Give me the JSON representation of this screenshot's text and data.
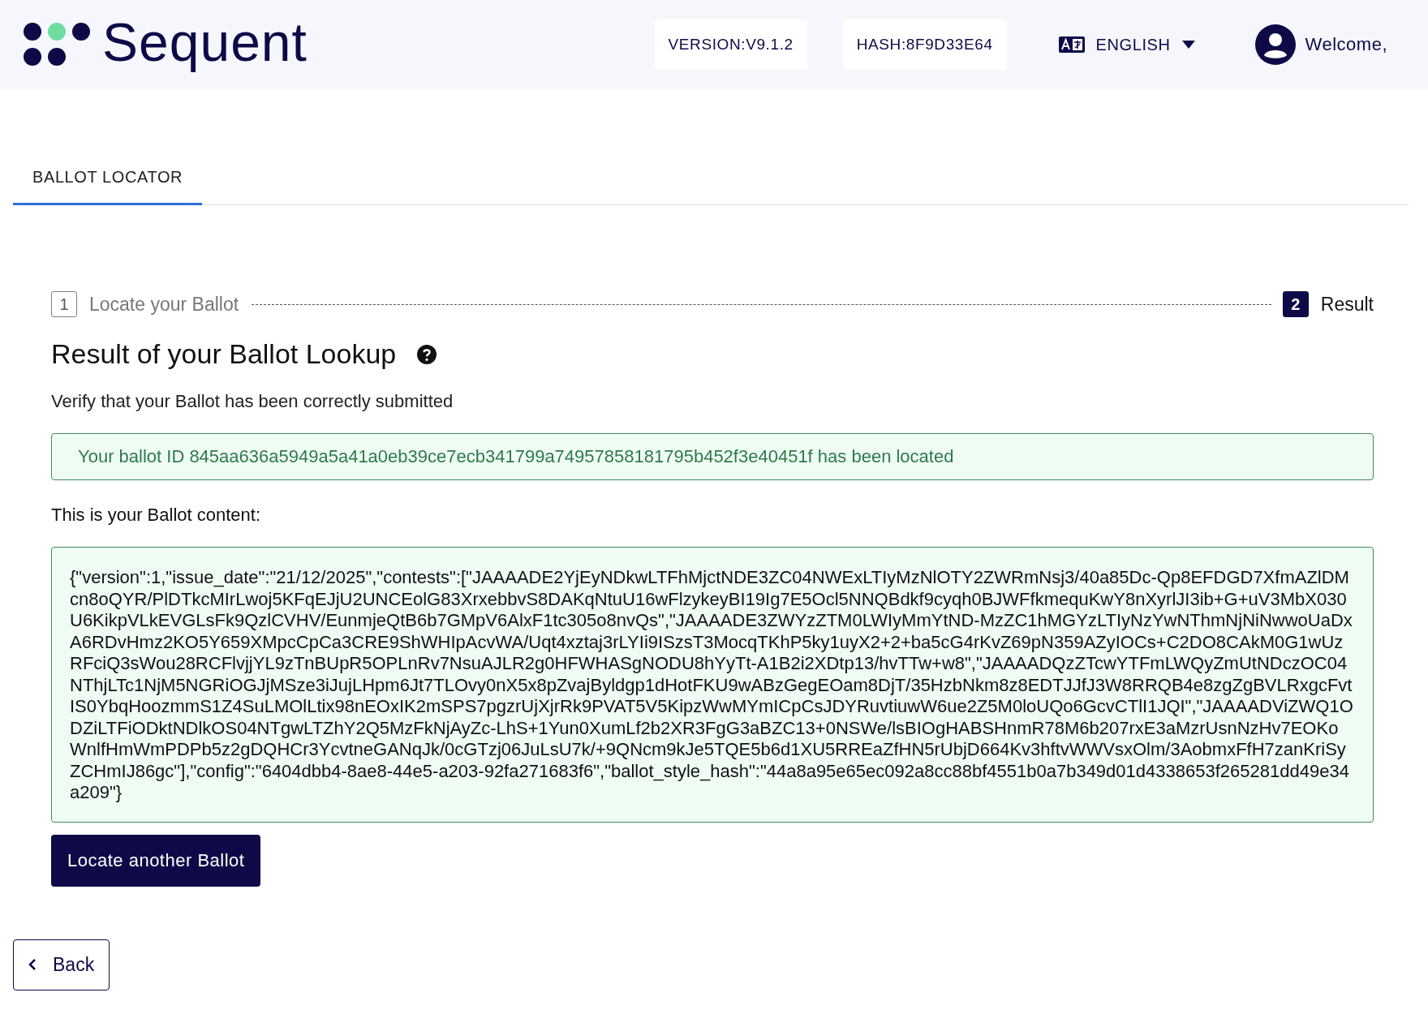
{
  "header": {
    "logo": "Sequent",
    "version": "VERSION:V9.1.2",
    "hash": "HASH:8F9D33E64",
    "language": "ENGLISH",
    "welcome": "Welcome,"
  },
  "tabs": [
    {
      "label": "BALLOT LOCATOR",
      "selected": true
    }
  ],
  "steps": [
    {
      "number": "1",
      "label": "Locate your Ballot",
      "selected": false
    },
    {
      "number": "2",
      "label": "Result",
      "selected": true
    }
  ],
  "title": "Result of your Ballot Lookup",
  "subtitle": "Verify that your Ballot has been correctly submitted",
  "alert": "Your ballot ID 845aa636a5949a5a41a0eb39ce7ecb341799a74957858181795b452f3e40451f has been located",
  "content_label": "This is your Ballot content:",
  "content": "{\"version\":1,\"issue_date\":\"21/12/2025\",\"contests\":[\"JAAAADE2YjEyNDkwLTFhMjctNDE3ZC04NWExLTIyMzNlOTY2ZWRmNsj3/40a85Dc-Qp8EFDGD7XfmAZlDMcn8oQYR/PlDTkcMIrLwoj5KFqEJjU2UNCEolG83XrxebbvS8DAKqNtuU16wFlzykeyBI19Ig7E5Ocl5NNQBdkf9cyqh0BJWFfkmequKwY8nXyrlJI3ib+G+uV3MbX030U6KikpVLkEVGLsFk9QzlCVHV/EunmjeQtB6b7GMpV6AlxF1tc305o8nvQs\",\"JAAAADE3ZWYzZTM0LWIyMmYtND-MzZC1hMGYzLTIyNzYwNThmNjNiNwwoUaDxA6RDvHmz2KO5Y659XMpcCpCa3CRE9ShWHIpAcvWA/Uqt4xztaj3rLYIi9ISzsT3MocqTKhP5ky1uyX2+2+ba5cG4rKvZ69pN359AZyIOCs+C2DO8CAkM0G1wUzRFciQ3sWou28RCFlvjjYL9zTnBUpR5OPLnRv7NsuAJLR2g0HFWHASgNODU8hYyTt-A1B2i2XDtp13/hvTTw+w8\",\"JAAAADQzZTcwYTFmLWQyZmUtNDczOC04NThjLTc1NjM5NGRiOGJjMSze3iJujLHpm6Jt7TLOvy0nX5x8pZvajByldgp1dHotFKU9wABzGegEOam8DjT/35HzbNkm8z8EDTJJfJ3W8RRQB4e8zgZgBVLRxgcFvtIS0YbqHoozmmS1Z4SuLMOlLtix98nEOxIK2mSPS7pgzrUjXjrRk9PVAT5V5KipzWwMYmICpCsJDYRuvtiuwW6ue2Z5M0loUQo6GcvCTlI1JQI\",\"JAAAADViZWQ1ODZiLTFiODktNDlkOS04NTgwLTZhY2Q5MzFkNjAyZc-LhS+1Yun0XumLf2b2XR3FgG3aBZC13+0NSWe/lsBIOgHABSHnmR78M6b207rxE3aMzrUsnNzHv7EOKoWnlfHmWmPDPb5z2gDQHCr3YcvtneGANqJk/0cGTzj06JuLsU7k/+9QNcm9kJe5TQE5b6d1XU5RREaZfHN5rUbjD664Kv3hftvWWVsxOlm/3AobmxFfH7zanKriSyZCHmIJ86gc\"],\"config\":\"6404dbb4-8ae8-44e5-a203-92fa271683f6\",\"ballot_style_hash\":\"44a8a95e65ec092a8cc88bf4551b0a7b349d01d4338653f265281dd49e34a209\"}",
  "locate_button": "Locate another Ballot",
  "back_button": "Back"
}
